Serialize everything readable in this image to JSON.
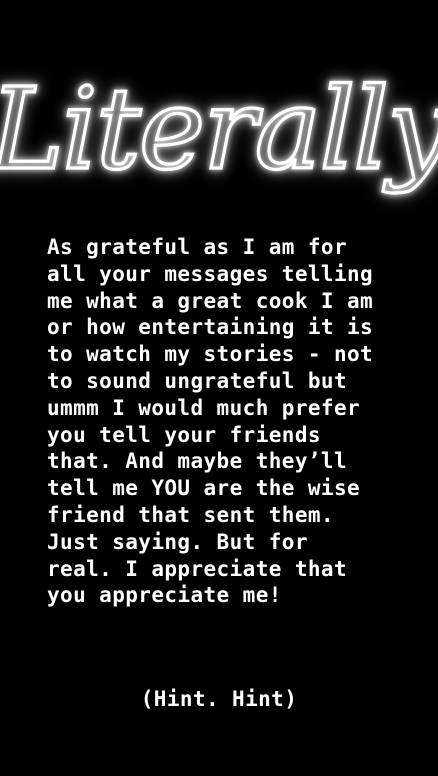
{
  "story": {
    "background": "#000000",
    "text_color": "#ffffff",
    "headline": "Literally",
    "body_lines": [
      "As grateful as I am for",
      "all your messages telling",
      "me what a great cook I am",
      "or how entertaining it is",
      "to watch my stories - not",
      "to sound ungrateful but",
      "ummm I would much prefer",
      "you tell your friends",
      "that. And maybe they’ll",
      "tell me YOU are the wise",
      "friend that sent them.",
      "Just saying. But for",
      "real. I appreciate that",
      "you appreciate me!"
    ],
    "footer": "(Hint. Hint)"
  }
}
